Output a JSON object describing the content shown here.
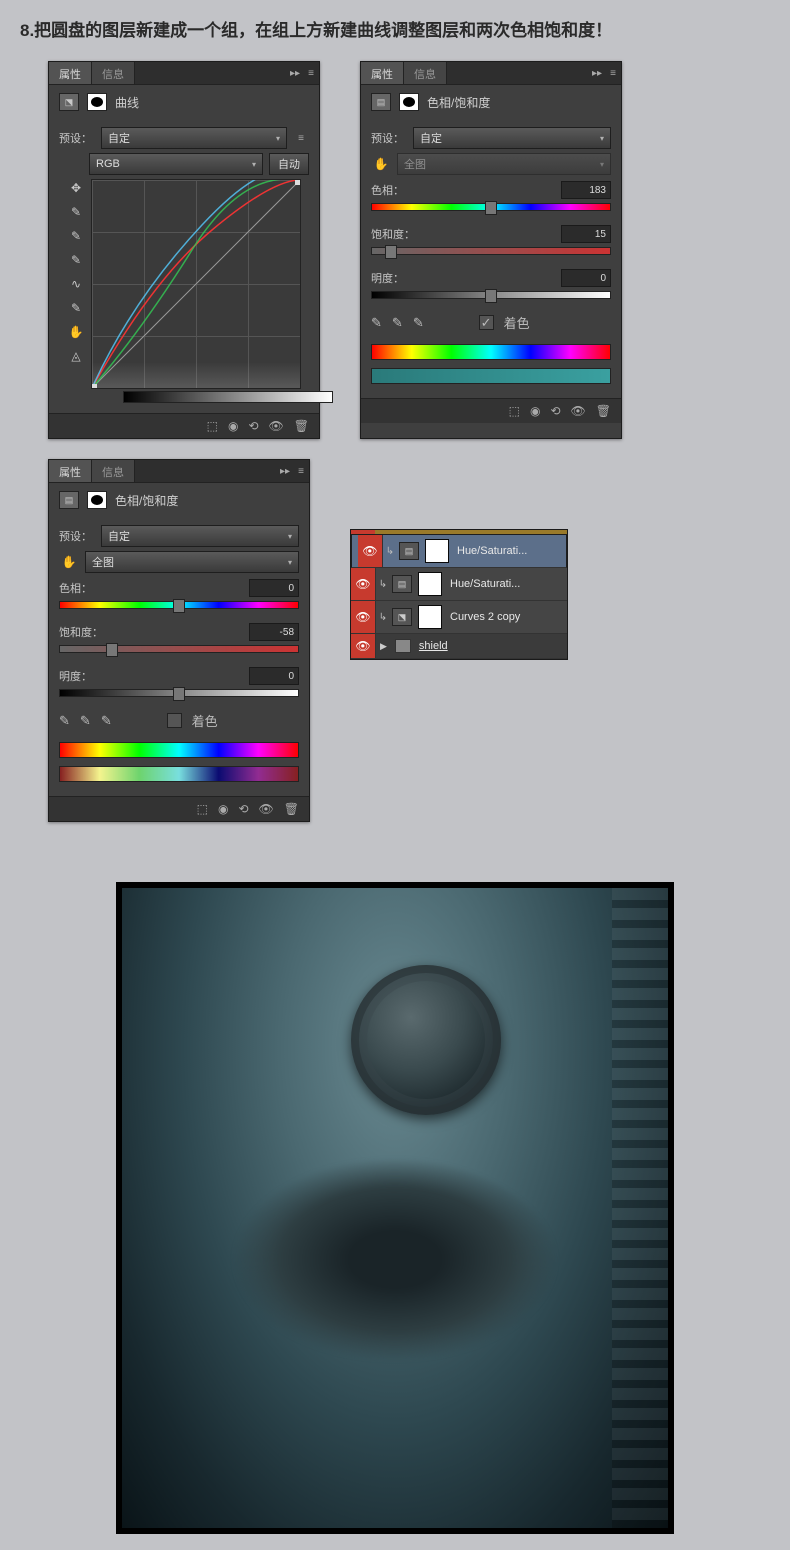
{
  "step_title": "8.把圆盘的图层新建成一个组，在组上方新建曲线调整图层和两次色相饱和度！",
  "panel_tabs": {
    "properties": "属性",
    "info": "信息"
  },
  "curves": {
    "title": "曲线",
    "preset_label": "预设：",
    "preset_value": "自定",
    "channel": "RGB",
    "auto_btn": "自动"
  },
  "hsl1": {
    "title": "色相/饱和度",
    "preset_label": "预设：",
    "preset_value": "自定",
    "range": "全图",
    "hue_label": "色相：",
    "hue_value": "183",
    "sat_label": "饱和度：",
    "sat_value": "15",
    "light_label": "明度：",
    "light_value": "0",
    "colorize": "着色",
    "colorize_checked": true
  },
  "hsl2": {
    "title": "色相/饱和度",
    "preset_label": "预设：",
    "preset_value": "自定",
    "range": "全图",
    "hue_label": "色相：",
    "hue_value": "0",
    "sat_label": "饱和度：",
    "sat_value": "-58",
    "light_label": "明度：",
    "light_value": "0",
    "colorize": "着色",
    "colorize_checked": false
  },
  "layers": [
    {
      "name": "Hue/Saturati...",
      "type": "hsl",
      "selected": true
    },
    {
      "name": "Hue/Saturati...",
      "type": "hsl",
      "selected": false
    },
    {
      "name": "Curves 2 copy",
      "type": "curves",
      "selected": false
    }
  ],
  "group_name": "shield"
}
